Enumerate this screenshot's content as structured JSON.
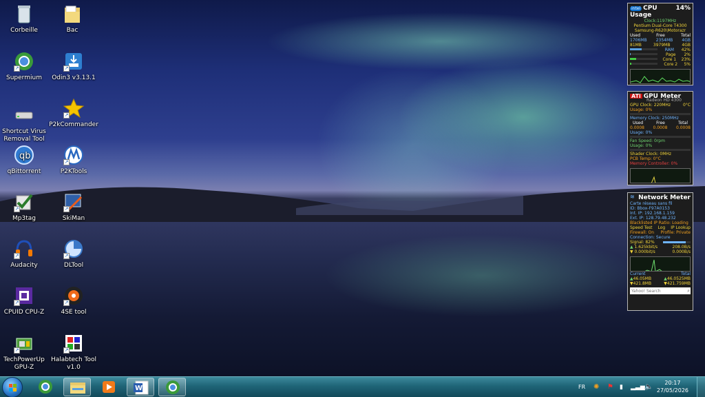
{
  "desktop_icons": [
    {
      "label": "Corbeille",
      "icon": "recycle-bin-icon"
    },
    {
      "label": "Bac",
      "icon": "folder-icon"
    },
    {
      "label": "Supermium",
      "icon": "browser-icon"
    },
    {
      "label": "Odin3 v3.13.1",
      "icon": "odin-installer-icon"
    },
    {
      "label": "Shortcut Virus Removal Tool",
      "icon": "drive-icon"
    },
    {
      "label": "P2kCommander",
      "icon": "star-icon"
    },
    {
      "label": "qBittorrent",
      "icon": "qbittorrent-icon"
    },
    {
      "label": "P2KTools",
      "icon": "motorola-icon"
    },
    {
      "label": "Mp3tag",
      "icon": "mp3tag-icon"
    },
    {
      "label": "SkiMan",
      "icon": "skiman-icon"
    },
    {
      "label": "Audacity",
      "icon": "audacity-icon"
    },
    {
      "label": "DLTool",
      "icon": "dltool-icon"
    },
    {
      "label": "CPUID CPU-Z",
      "icon": "cpuz-icon"
    },
    {
      "label": "4SE tool",
      "icon": "4se-tool-icon"
    },
    {
      "label": "TechPowerUp GPU-Z",
      "icon": "gpuz-icon"
    },
    {
      "label": "Halabtech Tool v1.0",
      "icon": "halabtech-icon"
    }
  ],
  "cpu_gadget": {
    "title": "CPU Usage",
    "percent": "14%",
    "clock": "Clock:1197MHz",
    "model": "Pentium Dual-Core T4300",
    "device": "Samsung-R620\\Motorazr",
    "headers": [
      "Used",
      "Free",
      "Total"
    ],
    "row1": [
      "1706MB",
      "2354MB",
      "4GB"
    ],
    "row2": [
      "81MB",
      "3979MB",
      "4GB"
    ],
    "meters": [
      {
        "label": "RAM",
        "value": "42%",
        "level": 0.42
      },
      {
        "label": "Page",
        "value": "2%",
        "level": 0.02
      },
      {
        "label": "Core 1",
        "value": "23%",
        "level": 0.23
      },
      {
        "label": "Core 2",
        "value": "5%",
        "level": 0.05
      }
    ]
  },
  "gpu_gadget": {
    "title": "GPU Meter",
    "model": "Radeon HD 4300",
    "clock": "GPU Clock: 220MHz",
    "temp": "0°C",
    "usage1": "Usage: 0%",
    "mem_clock": "Memory Clock: 250MHz",
    "headers": [
      "Used",
      "Free",
      "Total"
    ],
    "mem_row": [
      "0.0008",
      "0.0008",
      "0.0008"
    ],
    "usage2": "Usage: 0%",
    "fan": "Fan Speed: 0rpm",
    "usage3": "Usage: 0%",
    "shader": "Shader Clock: 0MHz",
    "pcb": "PCB Temp: 0°C",
    "mem_ctrl": "Memory Controller: 0%"
  },
  "net_gadget": {
    "title": "Network Meter",
    "adapter": "Carte réseau sans fil",
    "id": "ID: Bbox-F97A0153",
    "int_ip": "Int. IP: 192.168.1.159",
    "ext_ip": "Ext. IP: 128.79.48.232",
    "blacklist": "Blacklisted IP Ratio: Loading",
    "links": [
      "Speed Test",
      "Log",
      "IP Lookup"
    ],
    "firewall": "Firewall: On",
    "profile": "Profile: Private",
    "connection": "Connection: Secure",
    "signal": "Signal: 82%",
    "up_rate": "1.625kbit/s",
    "up_bytes": "208.0B/s",
    "down_rate": "0.000bit/s",
    "down_bytes": "0.000B/s",
    "current_label": "Current",
    "total_label": "Total",
    "cur_up": "46.05MB",
    "cur_down": "421.8MB",
    "tot_up": "46.0525MB",
    "tot_down": "421.759MB",
    "search_placeholder": "Yahoo! Search"
  },
  "taskbar": {
    "apps": [
      "browser-icon",
      "explorer-icon",
      "media-player-icon",
      "word-icon",
      "browser-icon"
    ],
    "language": "FR",
    "time": "20:17",
    "date": "27/05/2026"
  }
}
